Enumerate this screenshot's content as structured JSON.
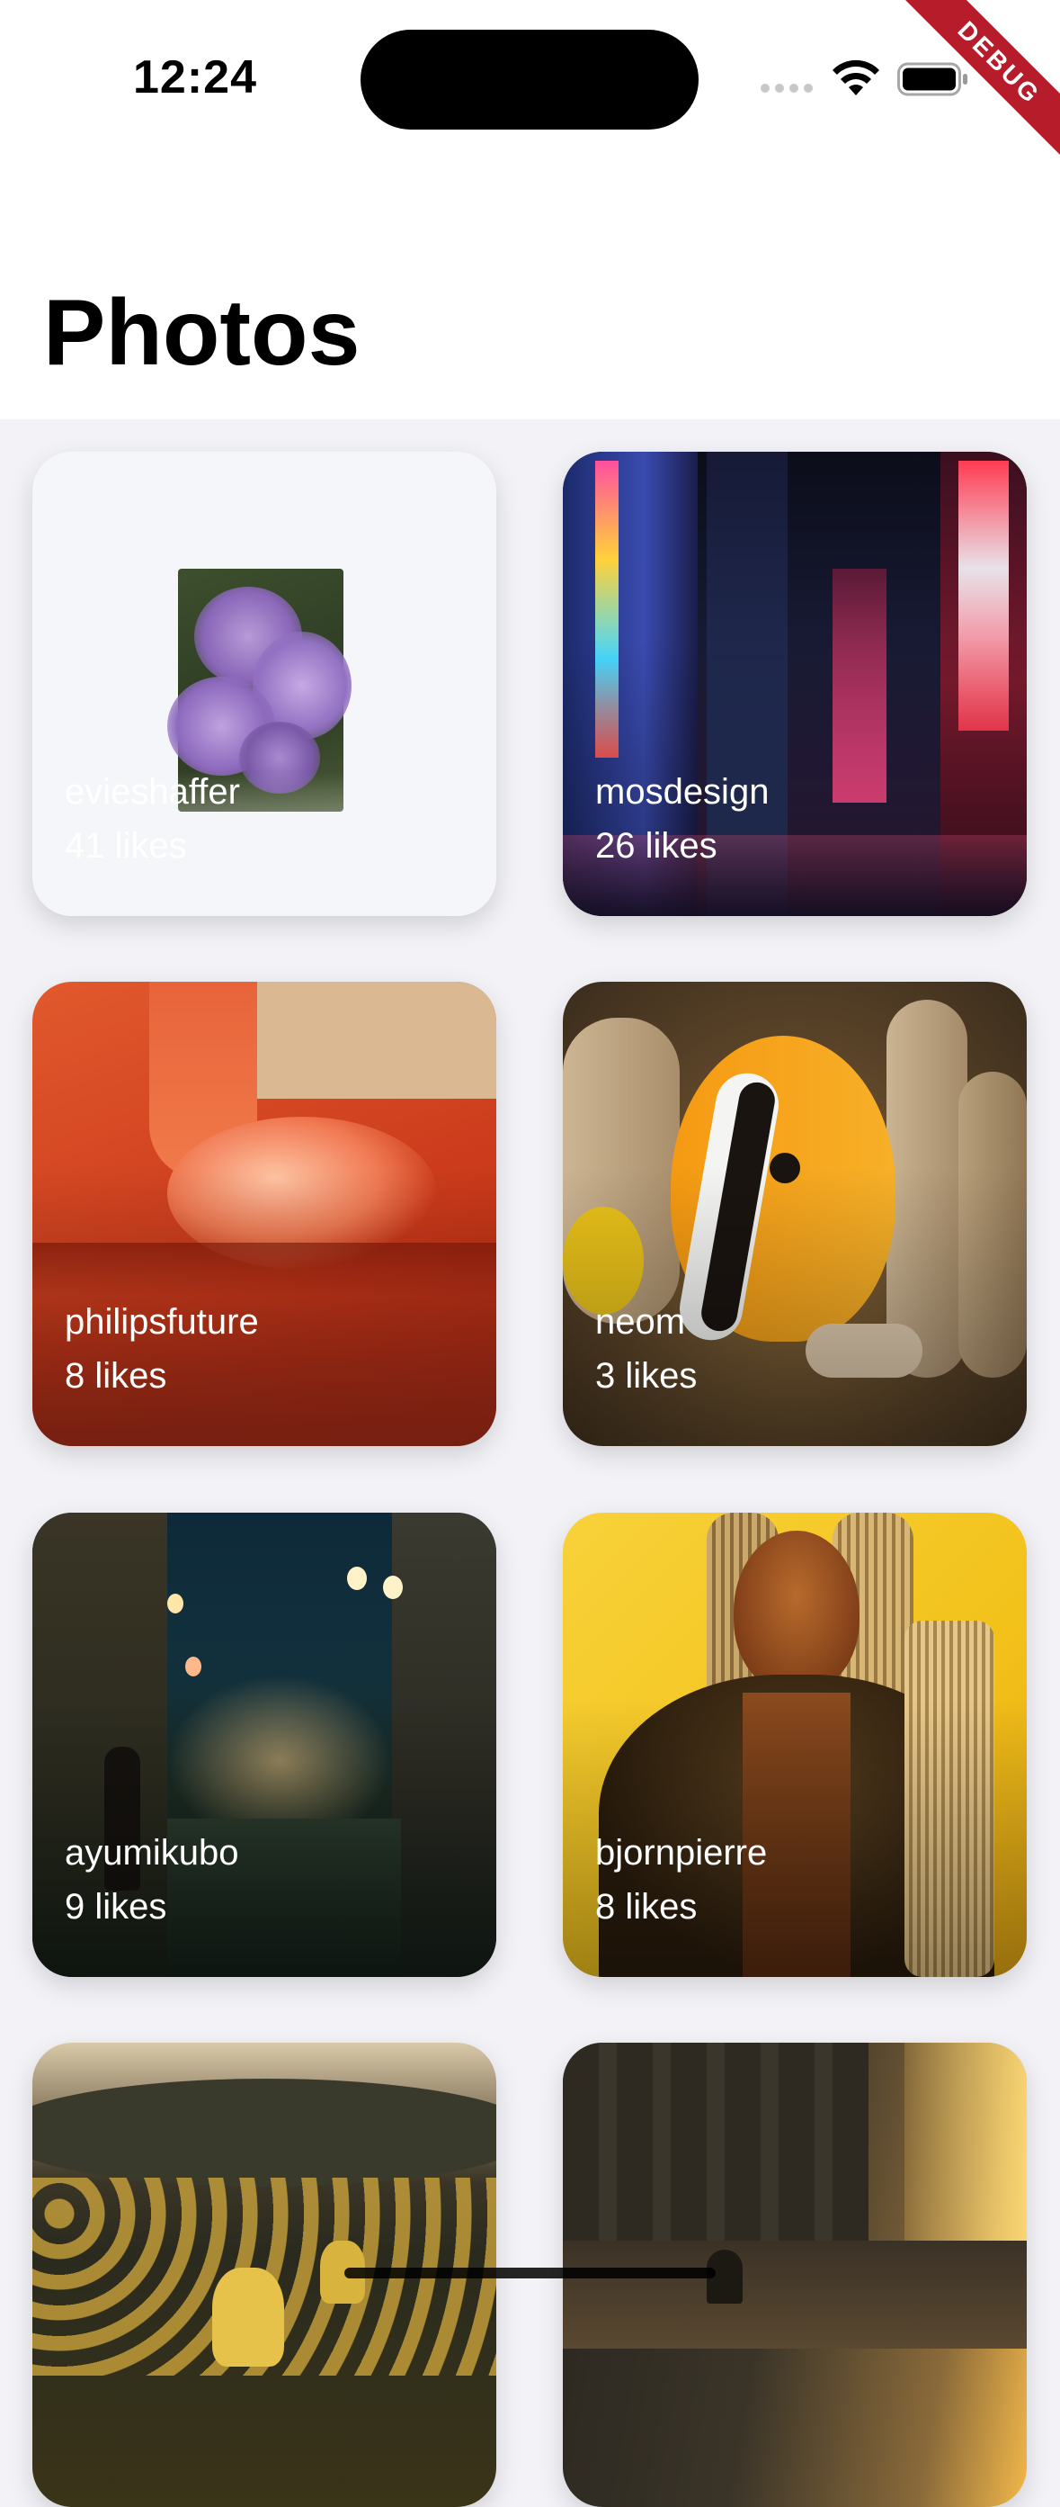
{
  "status": {
    "time": "12:24"
  },
  "debug_banner": "DEBUG",
  "page_title": "Photos",
  "photos": [
    {
      "author": "evieshaffer",
      "likes": "41 likes"
    },
    {
      "author": "mosdesign",
      "likes": "26 likes"
    },
    {
      "author": "philipsfuture",
      "likes": "8 likes"
    },
    {
      "author": "neom",
      "likes": "3 likes"
    },
    {
      "author": "ayumikubo",
      "likes": "9 likes"
    },
    {
      "author": "bjornpierre",
      "likes": "8 likes"
    },
    {
      "author": "",
      "likes": ""
    },
    {
      "author": "",
      "likes": ""
    }
  ]
}
